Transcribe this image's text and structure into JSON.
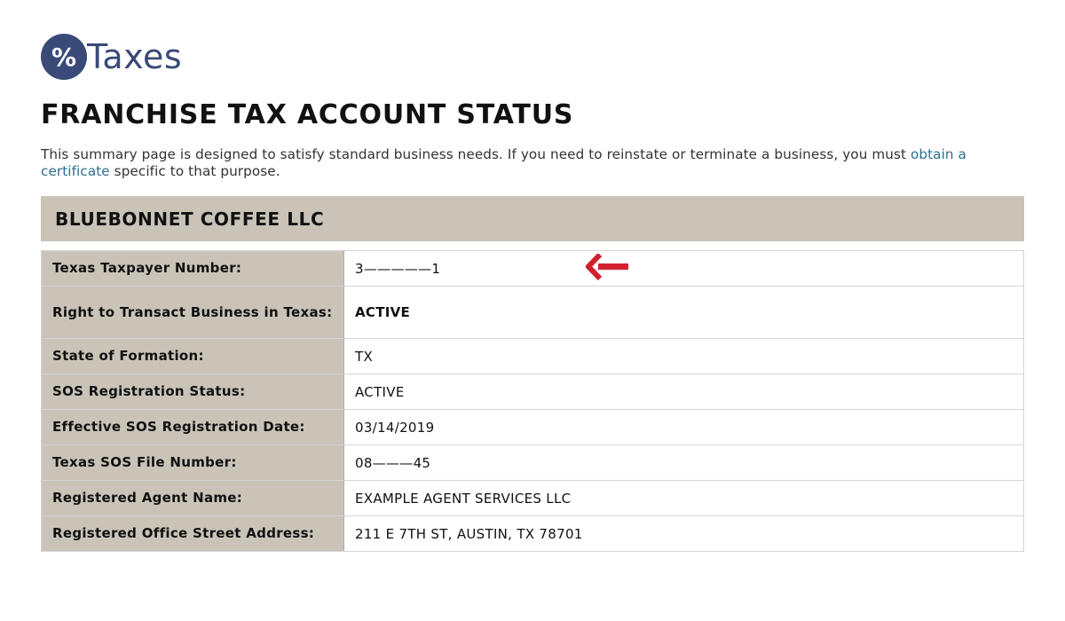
{
  "logo": {
    "symbol": "%",
    "text": "Taxes",
    "color": "#3a4a78"
  },
  "page_title": "FRANCHISE TAX ACCOUNT STATUS",
  "intro": {
    "text_before": "This summary page is designed to satisfy standard business needs. If you need to reinstate or terminate a business, you must ",
    "link_text": "obtain a certificate",
    "text_after": " specific to that purpose."
  },
  "entity_name": "BLUEBONNET COFFEE LLC",
  "details": [
    {
      "label": "Texas Taxpayer Number:",
      "value": "3—————1"
    },
    {
      "label": "Right to Transact Business in Texas:",
      "value": "ACTIVE"
    },
    {
      "label": "State of Formation:",
      "value": "TX"
    },
    {
      "label": "SOS Registration Status:",
      "value": "ACTIVE"
    },
    {
      "label": "Effective SOS Registration Date:",
      "value": "03/14/2019"
    },
    {
      "label": "Texas SOS File Number:",
      "value": "08———45"
    },
    {
      "label": "Registered Agent Name:",
      "value": "EXAMPLE AGENT SERVICES LLC"
    },
    {
      "label": "Registered Office Street Address:",
      "value": "211 E 7TH ST, AUSTIN, TX 78701"
    }
  ],
  "colors": {
    "header_bg": "#c9c3b8",
    "link": "#2e6d8f",
    "arrow": "#d0202e"
  },
  "annotation": {
    "icon": "left-arrow-icon"
  }
}
